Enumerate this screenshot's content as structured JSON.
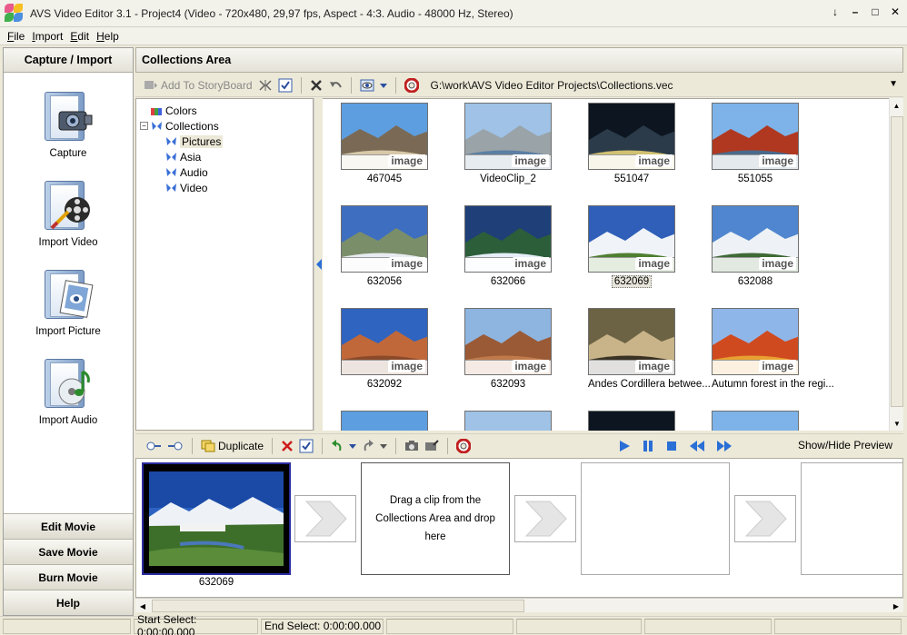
{
  "window": {
    "title": "AVS Video Editor 3.1 - Project4 (Video - 720x480, 29,97 fps, Aspect - 4:3. Audio - 48000 Hz, Stereo)"
  },
  "menu": [
    "File",
    "Import",
    "Edit",
    "Help"
  ],
  "left_panel": {
    "header": "Capture / Import",
    "tools": [
      {
        "label": "Capture",
        "icon": "camera-icon"
      },
      {
        "label": "Import Video",
        "icon": "film-reel-icon"
      },
      {
        "label": "Import Picture",
        "icon": "picture-icon"
      },
      {
        "label": "Import Audio",
        "icon": "music-disc-icon"
      }
    ],
    "sections": [
      "Edit Movie",
      "Save Movie",
      "Burn Movie",
      "Help"
    ]
  },
  "collections": {
    "header": "Collections Area",
    "add_to_storyboard": "Add To StoryBoard",
    "path": "G:\\work\\AVS Video Editor Projects\\Collections.vec",
    "tree": [
      {
        "label": "Colors",
        "level": 0,
        "toggle": ""
      },
      {
        "label": "Collections",
        "level": 0,
        "toggle": "−"
      },
      {
        "label": "Pictures",
        "level": 1,
        "toggle": "",
        "selected": true
      },
      {
        "label": "Asia",
        "level": 1,
        "toggle": ""
      },
      {
        "label": "Audio",
        "level": 1,
        "toggle": ""
      },
      {
        "label": "Video",
        "level": 1,
        "toggle": ""
      }
    ],
    "badge": "image",
    "items": [
      "467045",
      "VideoClip_2",
      "551047",
      "551055",
      "632056",
      "632066",
      "632069",
      "632088",
      "632092",
      "632093",
      "Andes Cordillera betwee...",
      "Autumn forest in the regi..."
    ],
    "selected_item": "632069"
  },
  "storyboard": {
    "duplicate": "Duplicate",
    "show_hide": "Show/Hide Preview",
    "clip_caption": "632069",
    "drop_hint": "Drag a clip from the Collections Area and drop here"
  },
  "status": {
    "start_select": "Start Select: 0:00:00.000",
    "end_select": "End Select: 0:00:00.000"
  },
  "colors": {
    "accent": "#2d2da0",
    "chrome": "#ece9d8"
  }
}
